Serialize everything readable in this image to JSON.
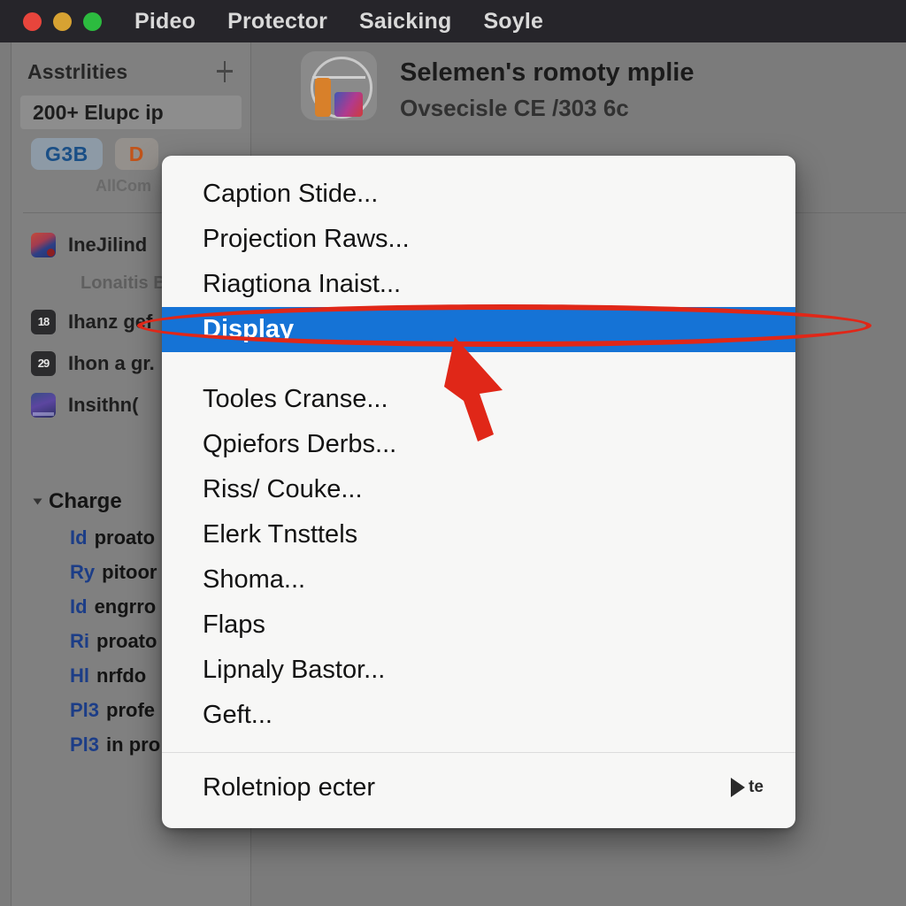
{
  "titlebar": {
    "traffic_lights": [
      "close",
      "minimize",
      "zoom"
    ],
    "menus": [
      "Pideo",
      "Protector",
      "Saicking",
      "Soyle"
    ]
  },
  "sidebar": {
    "header_title": "Asstrlities",
    "filter_icon": "filter-slider-icon",
    "selected_row": "200+ Elupc ip",
    "chips": [
      {
        "label": "G3B",
        "color": "#1a4f86"
      },
      {
        "label": "D",
        "color": "#c2541a"
      }
    ],
    "subtle_label": "AllCom",
    "items": [
      {
        "icon": "photo-thumbnail-icon",
        "label": "IneJilind",
        "sub": "Lonaitis B"
      },
      {
        "icon": "dark-badge-icon",
        "glyph": "18",
        "label": "Ihanz gef"
      },
      {
        "icon": "dark-badge-icon",
        "glyph": "29",
        "label": "Ihon a gr."
      },
      {
        "icon": "image-thumbnail-icon",
        "label": "Insithn("
      }
    ],
    "group": {
      "title": "Charge",
      "expanded": true,
      "items": [
        {
          "prefix": "Id",
          "text": "proato"
        },
        {
          "prefix": "Ry",
          "text": "pitoor"
        },
        {
          "prefix": "Id",
          "text": "engrro"
        },
        {
          "prefix": "Ri",
          "text": "proato"
        },
        {
          "prefix": "Hl",
          "text": "nrfdo"
        },
        {
          "prefix": "Pl3",
          "text": "profe"
        },
        {
          "prefix": "Pl3",
          "text": "in pro"
        }
      ]
    }
  },
  "content": {
    "app_icon": "basket-app-icon",
    "title": "Selemen's romoty mplie",
    "subtitle": "Ovsecisle CE /303 6c"
  },
  "context_menu": {
    "items": [
      {
        "label": "Caption Stide...",
        "highlighted": false
      },
      {
        "label": "Projection Raws...",
        "highlighted": false
      },
      {
        "label": "Riagtiona Inaist...",
        "highlighted": false
      },
      {
        "label": "Display",
        "highlighted": true
      },
      {
        "label": "Tooles Cranse...",
        "highlighted": false
      },
      {
        "label": "Qpiefors Derbs...",
        "highlighted": false
      },
      {
        "label": "Riss/ Couke...",
        "highlighted": false
      },
      {
        "label": "Elerk Tnsttels",
        "highlighted": false
      },
      {
        "label": "Shoma...",
        "highlighted": false
      },
      {
        "label": "Flaps",
        "highlighted": false
      },
      {
        "label": "Lipnaly Bastor...",
        "highlighted": false
      },
      {
        "label": "Geft...",
        "highlighted": false
      }
    ],
    "footer": {
      "label": "Roletniop ecter",
      "submenu_icon": "play-triangle-icon",
      "shortcut": "te"
    },
    "highlight_color": "#1573d6"
  },
  "annotations": {
    "ellipse_color": "#e02718",
    "arrow_color": "#e02718",
    "target_label": "Display"
  }
}
